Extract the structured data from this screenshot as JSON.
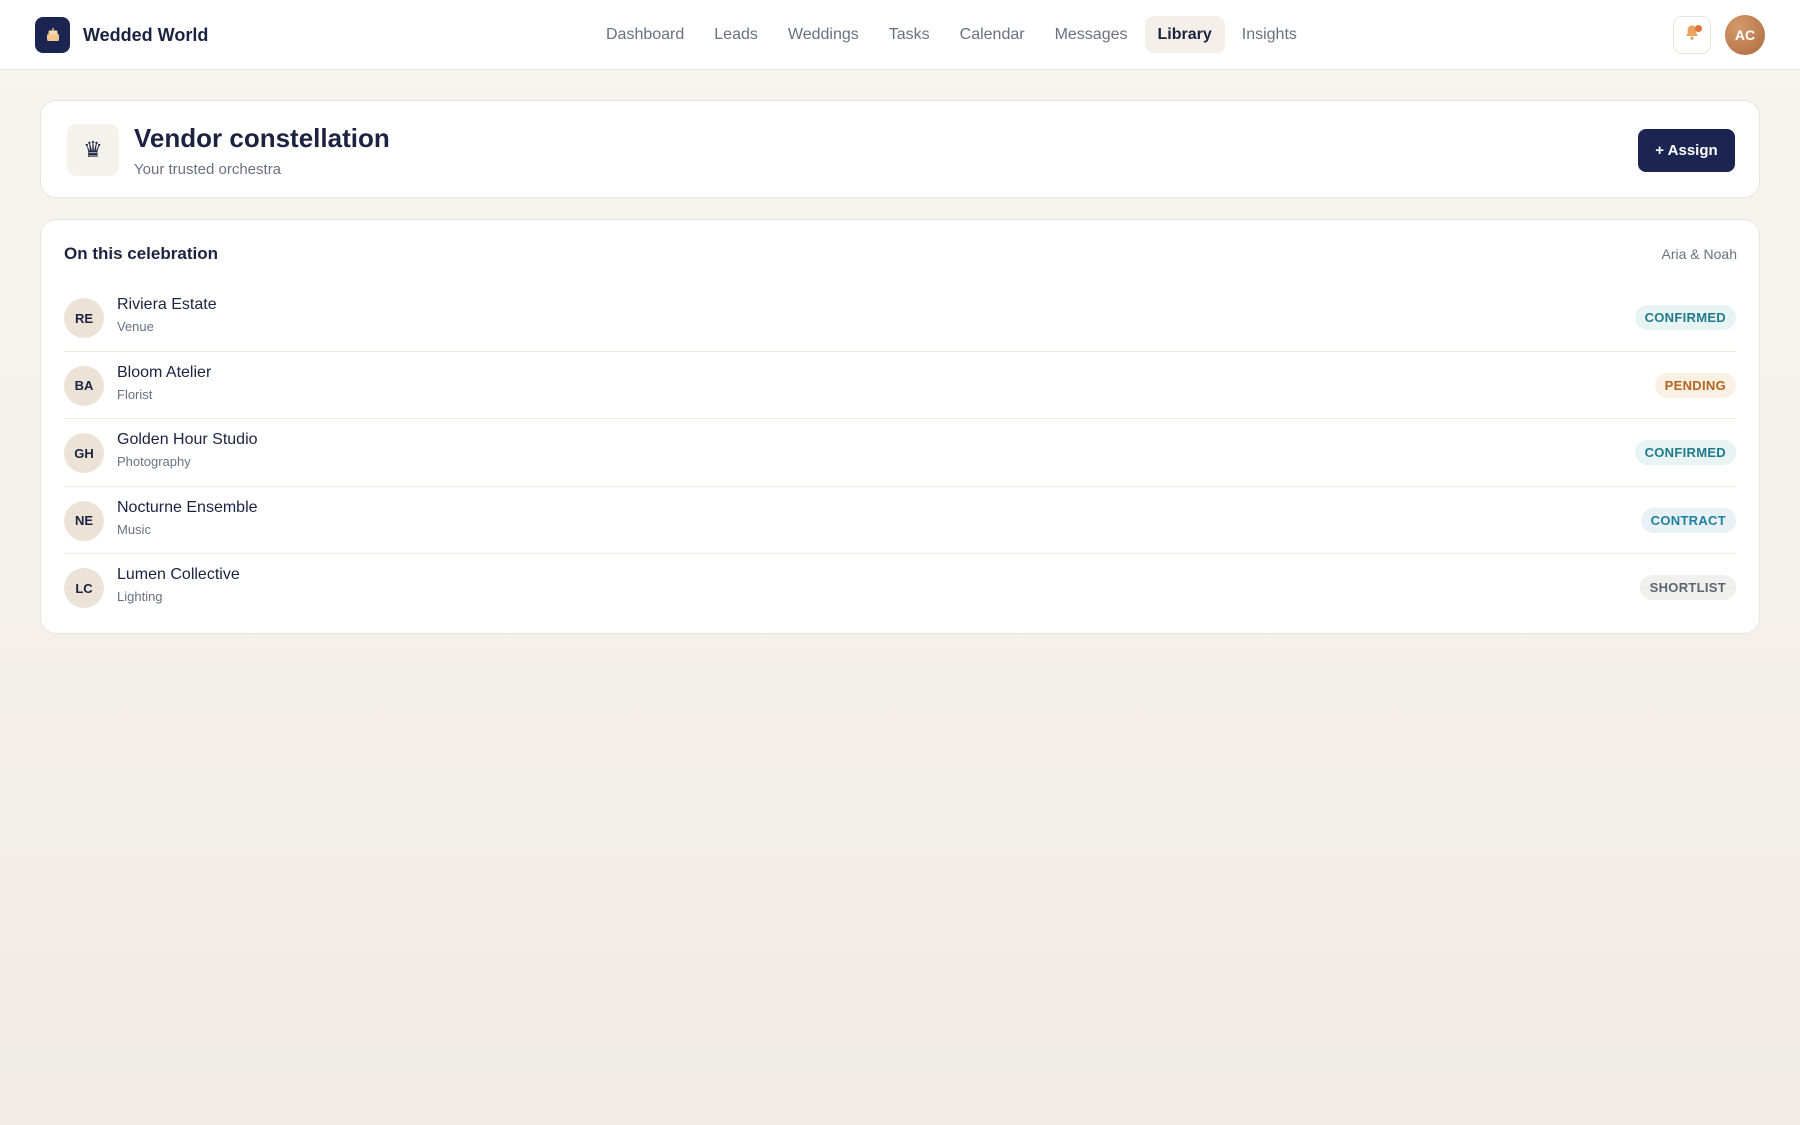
{
  "app": {
    "name": "Wedded World",
    "user_initials": "AC"
  },
  "nav": {
    "items": [
      {
        "label": "Dashboard",
        "active": false
      },
      {
        "label": "Leads",
        "active": false
      },
      {
        "label": "Weddings",
        "active": false
      },
      {
        "label": "Tasks",
        "active": false
      },
      {
        "label": "Calendar",
        "active": false
      },
      {
        "label": "Messages",
        "active": false
      },
      {
        "label": "Library",
        "active": true
      },
      {
        "label": "Insights",
        "active": false
      }
    ]
  },
  "header": {
    "icon": "crown-icon",
    "title": "Vendor constellation",
    "subtitle": "Your trusted orchestra",
    "assign_label": "+ Assign"
  },
  "vendors": {
    "title": "On this celebration",
    "couple": "Aria & Noah",
    "items": [
      {
        "initials": "RE",
        "name": "Riviera Estate",
        "category": "Venue",
        "status": "CONFIRMED",
        "status_color": "#1f7a8c",
        "status_bg": "#e8f3f4"
      },
      {
        "initials": "BA",
        "name": "Bloom Atelier",
        "category": "Florist",
        "status": "PENDING",
        "status_color": "#b5651d",
        "status_bg": "#fbf0e4"
      },
      {
        "initials": "GH",
        "name": "Golden Hour Studio",
        "category": "Photography",
        "status": "CONFIRMED",
        "status_color": "#1f7a8c",
        "status_bg": "#e8f3f4"
      },
      {
        "initials": "NE",
        "name": "Nocturne Ensemble",
        "category": "Music",
        "status": "CONTRACT",
        "status_color": "#1f7fa0",
        "status_bg": "#e8f2f6"
      },
      {
        "initials": "LC",
        "name": "Lumen Collective",
        "category": "Lighting",
        "status": "SHORTLIST",
        "status_color": "#5d6470",
        "status_bg": "#f0f0ef"
      }
    ]
  },
  "colors": {
    "brand": "#1c2552",
    "accent": "#e0713b",
    "avatar": "#b9784c"
  }
}
